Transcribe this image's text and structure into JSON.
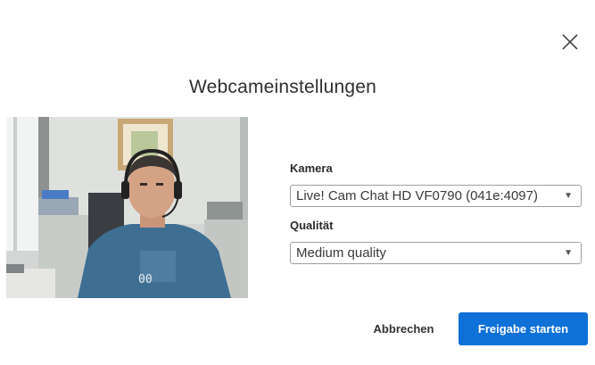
{
  "dialog": {
    "title": "Webcameinstellungen",
    "close_icon": "close-icon"
  },
  "camera": {
    "label": "Kamera",
    "selected": "Live! Cam Chat HD VF0790 (041e:4097)"
  },
  "quality": {
    "label": "Qualität",
    "selected": "Medium quality"
  },
  "actions": {
    "cancel_label": "Abbrechen",
    "share_label": "Freigabe starten"
  },
  "colors": {
    "primary": "#0f70d7",
    "border": "#9aa1a8"
  }
}
